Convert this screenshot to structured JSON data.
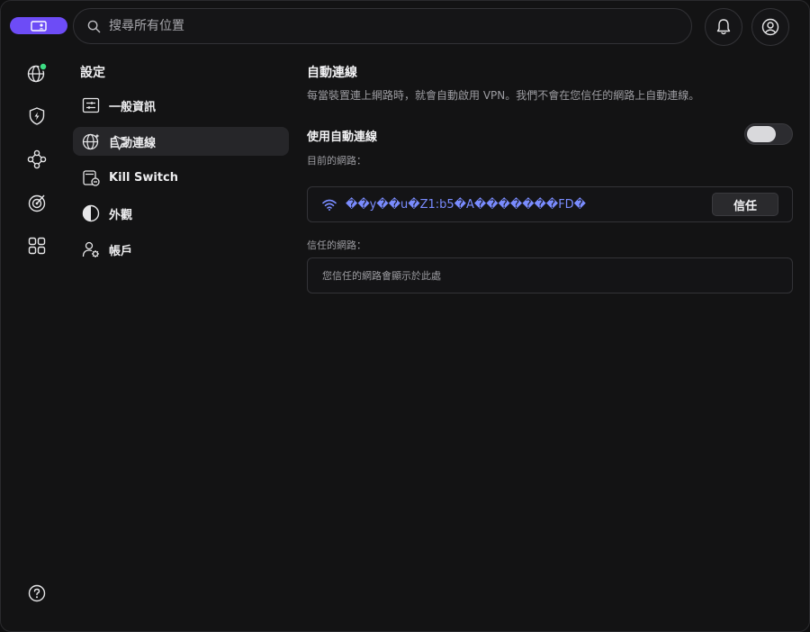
{
  "topbar": {
    "search_placeholder": "搜尋所有位置"
  },
  "rail": {
    "items": [
      "globe-status-icon",
      "shield-bolt-icon",
      "nodes-icon",
      "radar-icon",
      "grid-icon"
    ],
    "help_icon": "help-icon"
  },
  "settings_nav": {
    "title": "設定",
    "items": [
      {
        "label": "一般資訊",
        "icon": "sliders-icon"
      },
      {
        "label": "自動連線",
        "icon": "globe-sparkle-icon"
      },
      {
        "label": "Kill Switch",
        "icon": "killswitch-icon"
      },
      {
        "label": "外觀",
        "icon": "half-circle-icon"
      },
      {
        "label": "帳戶",
        "icon": "account-gear-icon"
      }
    ],
    "active_index": 1
  },
  "content": {
    "title": "自動連線",
    "description": "每當裝置連上網路時，就會自動啟用 VPN。我們不會在您信任的網路上自動連線。",
    "toggle_label": "使用自動連線",
    "toggle_on": false,
    "current_network_label": "目前的網路：",
    "current_network_name": "��y��u�Z1:b5�A�������FD�",
    "trust_button": "信任",
    "trusted_networks_label": "信任的網路：",
    "trusted_networks_empty": "您信任的網路會顯示於此處"
  },
  "colors": {
    "accent": "#6d4cf6",
    "status_green": "#3ddc84",
    "ssid_blue": "#7a8cff"
  }
}
